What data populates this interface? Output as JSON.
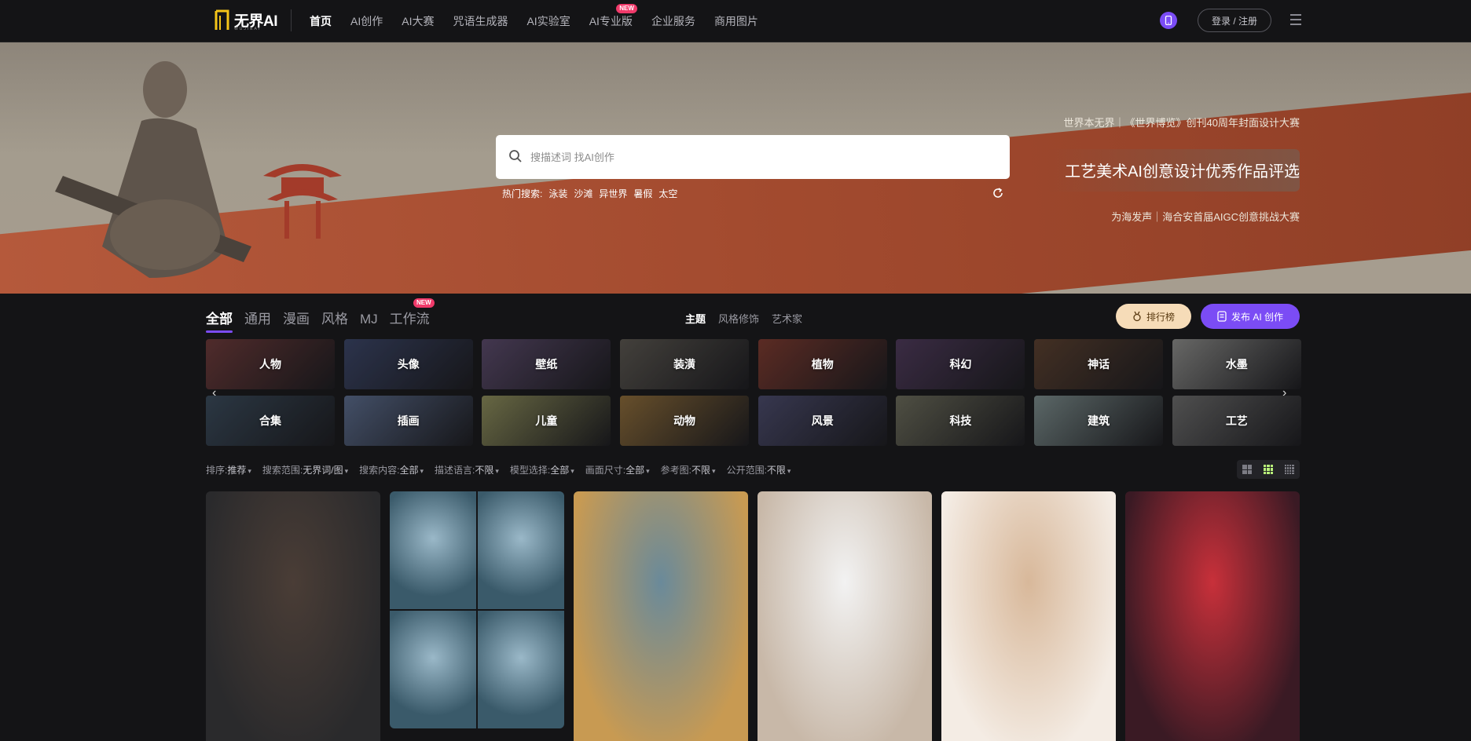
{
  "header": {
    "logo_text": "无界AI",
    "logo_sub": "WUJIEAI",
    "nav": [
      {
        "label": "首页",
        "active": true,
        "badge": ""
      },
      {
        "label": "AI创作",
        "active": false,
        "badge": ""
      },
      {
        "label": "AI大赛",
        "active": false,
        "badge": ""
      },
      {
        "label": "咒语生成器",
        "active": false,
        "badge": ""
      },
      {
        "label": "AI实验室",
        "active": false,
        "badge": ""
      },
      {
        "label": "AI专业版",
        "active": false,
        "badge": "NEW"
      },
      {
        "label": "企业服务",
        "active": false,
        "badge": ""
      },
      {
        "label": "商用图片",
        "active": false,
        "badge": ""
      }
    ],
    "login_label": "登录 / 注册",
    "accent": "#7b4cf5"
  },
  "banner": {
    "search_placeholder": "搜描述词 找AI创作",
    "hot_label": "热门搜索:",
    "hot_tags": [
      "泳装",
      "沙滩",
      "异世界",
      "暑假",
      "太空"
    ],
    "promo_1": "世界本无界｜《世界博览》创刊40周年封面设计大赛",
    "promo_2": "工艺美术AI创意设计优秀作品评选",
    "promo_3": "为海发声｜海合安首届AIGC创意挑战大赛"
  },
  "tabs": {
    "categories": [
      {
        "label": "全部",
        "active": true,
        "badge": ""
      },
      {
        "label": "通用",
        "active": false,
        "badge": ""
      },
      {
        "label": "漫画",
        "active": false,
        "badge": ""
      },
      {
        "label": "风格",
        "active": false,
        "badge": ""
      },
      {
        "label": "MJ",
        "active": false,
        "badge": ""
      },
      {
        "label": "工作流",
        "active": false,
        "badge": "NEW"
      }
    ],
    "sub": [
      {
        "label": "主题",
        "active": true
      },
      {
        "label": "风格修饰",
        "active": false
      },
      {
        "label": "艺术家",
        "active": false
      }
    ],
    "rank_label": "排行榜",
    "publish_label": "发布 AI 创作"
  },
  "category_cards": [
    {
      "label": "人物",
      "color": "#6b3a3a"
    },
    {
      "label": "头像",
      "color": "#3b4566"
    },
    {
      "label": "壁纸",
      "color": "#5a4a6a"
    },
    {
      "label": "装潢",
      "color": "#5a5650"
    },
    {
      "label": "植物",
      "color": "#7a3a30"
    },
    {
      "label": "科幻",
      "color": "#4e3a5a"
    },
    {
      "label": "神话",
      "color": "#5a4030"
    },
    {
      "label": "水墨",
      "color": "#8a8a88"
    },
    {
      "label": "合集",
      "color": "#3a4a5a"
    },
    {
      "label": "插画",
      "color": "#5a6a8a"
    },
    {
      "label": "儿童",
      "color": "#8a8a5a"
    },
    {
      "label": "动物",
      "color": "#8a6a3a"
    },
    {
      "label": "风景",
      "color": "#4a4a6a"
    },
    {
      "label": "科技",
      "color": "#6a6a5a"
    },
    {
      "label": "建筑",
      "color": "#7a8a8a"
    },
    {
      "label": "工艺",
      "color": "#6a6a6a"
    }
  ],
  "filters": [
    {
      "key": "排序:",
      "value": "推荐"
    },
    {
      "key": "搜索范围:",
      "value": "无界词/图"
    },
    {
      "key": "搜索内容:",
      "value": "全部"
    },
    {
      "key": "描述语言:",
      "value": "不限"
    },
    {
      "key": "模型选择:",
      "value": "全部"
    },
    {
      "key": "画面尺寸:",
      "value": "全部"
    },
    {
      "key": "参考图:",
      "value": "不限"
    },
    {
      "key": "公开范围:",
      "value": "不限"
    }
  ],
  "gallery_colors": [
    [
      "#2a2a2c",
      "#4a3d36"
    ],
    [
      "#3a5a6a",
      "#9ab8c8"
    ],
    [
      "#c89a52",
      "#6a8a9a"
    ],
    [
      "#c8b8a8",
      "#f2f2f2"
    ],
    [
      "#f4ece4",
      "#d8b89a"
    ],
    [
      "#3a1a24",
      "#c8303a"
    ]
  ]
}
